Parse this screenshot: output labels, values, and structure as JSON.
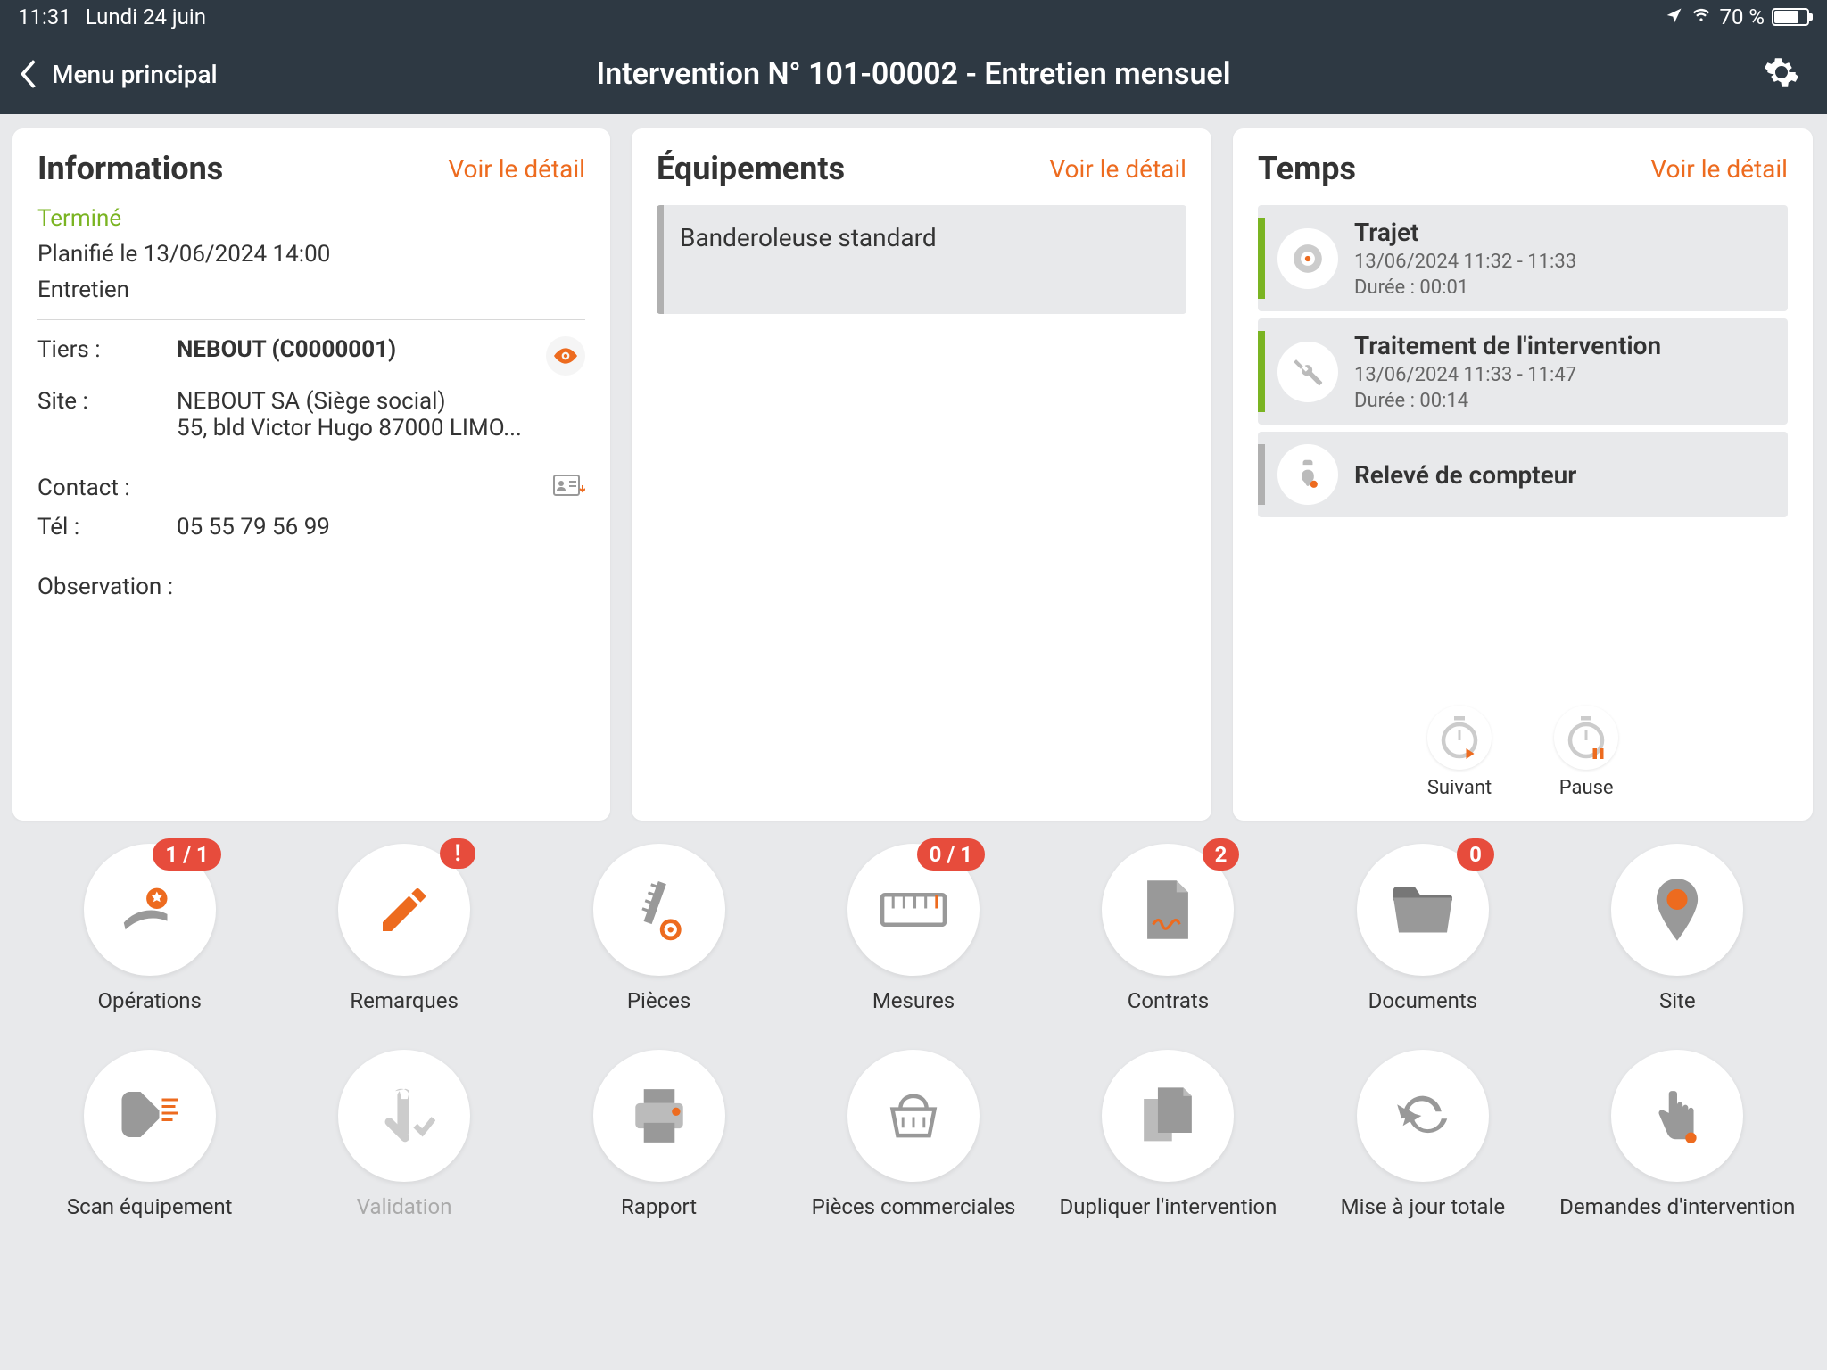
{
  "status": {
    "time": "11:31",
    "date": "Lundi 24 juin",
    "battery": "70 %"
  },
  "nav": {
    "back": "Menu principal",
    "title": "Intervention N° 101-00002 - Entretien mensuel"
  },
  "info": {
    "title": "Informations",
    "detail": "Voir le détail",
    "status": "Terminé",
    "planned": "Planifié le 13/06/2024 14:00",
    "type": "Entretien",
    "tiers_label": "Tiers :",
    "tiers_value": "NEBOUT (C0000001)",
    "site_label": "Site :",
    "site_value1": "NEBOUT SA (Siège social)",
    "site_value2": "55, bld Victor Hugo 87000 LIMO...",
    "contact_label": "Contact :",
    "tel_label": "Tél :",
    "tel_value": "05 55 79 56 99",
    "obs_label": "Observation :"
  },
  "equip": {
    "title": "Équipements",
    "detail": "Voir le détail",
    "item": "Banderoleuse standard"
  },
  "temps": {
    "title": "Temps",
    "detail": "Voir le détail",
    "items": [
      {
        "title": "Trajet",
        "range": "13/06/2024 11:32 - 11:33",
        "dur": "Durée : 00:01"
      },
      {
        "title": "Traitement de l'intervention",
        "range": "13/06/2024 11:33 - 11:47",
        "dur": "Durée : 00:14"
      },
      {
        "title": "Relevé de compteur",
        "range": "",
        "dur": ""
      }
    ],
    "suivant": "Suivant",
    "pause": "Pause"
  },
  "grid": {
    "operations": "Opérations",
    "operations_badge": "1 / 1",
    "remarques": "Remarques",
    "pieces": "Pièces",
    "mesures": "Mesures",
    "mesures_badge": "0 / 1",
    "contrats": "Contrats",
    "contrats_badge": "2",
    "documents": "Documents",
    "documents_badge": "0",
    "site": "Site",
    "scan": "Scan équipement",
    "validation": "Validation",
    "rapport": "Rapport",
    "pieces_com": "Pièces commerciales",
    "dupliquer": "Dupliquer l'intervention",
    "maj": "Mise à jour totale",
    "demandes": "Demandes d'intervention"
  }
}
